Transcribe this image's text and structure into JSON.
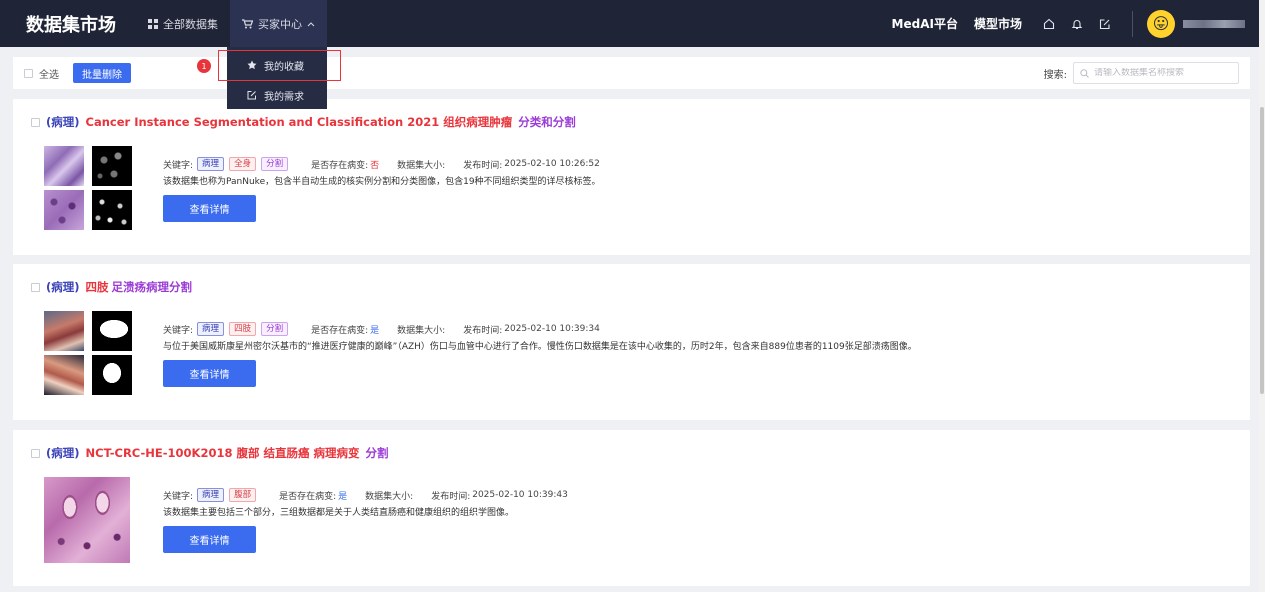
{
  "header": {
    "logo": "数据集市场",
    "nav": {
      "all": "全部数据集",
      "buyer": "买家中心"
    },
    "right_links": {
      "medai": "MedAI平台",
      "models": "模型市场"
    }
  },
  "dropdown": {
    "favorites": "我的收藏",
    "needs": "我的需求",
    "badge": "1"
  },
  "toolbar": {
    "select_all": "全选",
    "bulk_delete": "批量删除",
    "search_label": "搜索:",
    "search_placeholder": "请输入数据集名称搜索"
  },
  "labels": {
    "keywords": "关键字:",
    "lesion": "是否存在病变:",
    "size": "数据集大小:",
    "published": "发布时间:",
    "detail": "查看详情"
  },
  "datasets": [
    {
      "tag": "(病理)",
      "name": "Cancer Instance Segmentation and Classification 2021 组织病理肿瘤",
      "cats": "分类和分割",
      "keywords": [
        "病理",
        "全身",
        "分割"
      ],
      "lesion": "否",
      "published": "2025-02-10 10:26:52",
      "description": "该数据集也称为PanNuke，包含半自动生成的核实例分割和分类图像，包含19种不同组织类型的详尽核标签。"
    },
    {
      "tag": "(病理)",
      "name": "四肢",
      "cats": "足溃疡病理分割",
      "keywords": [
        "病理",
        "四肢",
        "分割"
      ],
      "lesion": "是",
      "published": "2025-02-10 10:39:34",
      "description": "与位于美国威斯康星州密尔沃基市的“推进医疗健康的巅峰”（AZH）伤口与血管中心进行了合作。慢性伤口数据集是在该中心收集的，历时2年，包含来自889位患者的1109张足部溃疡图像。"
    },
    {
      "tag": "(病理)",
      "name": "NCT-CRC-HE-100K2018 腹部 结直肠癌 病理病变",
      "cats": "分割",
      "keywords": [
        "病理",
        "腹部"
      ],
      "lesion": "是",
      "published": "2025-02-10 10:39:43",
      "description": "该数据集主要包括三个部分，三组数据都是关于人类结直肠癌和健康组织的组织学图像。"
    }
  ]
}
